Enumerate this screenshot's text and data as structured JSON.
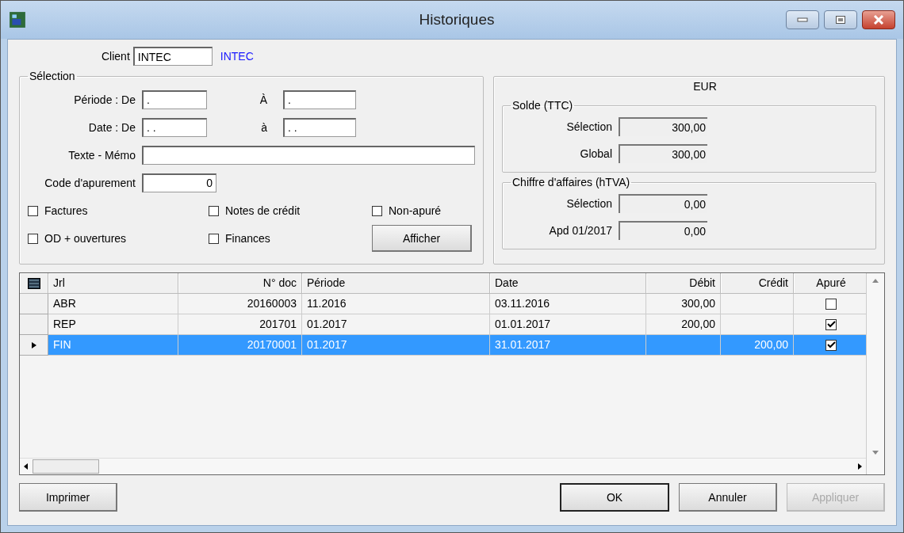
{
  "window": {
    "title": "Historiques"
  },
  "client": {
    "label": "Client",
    "value": "INTEC",
    "name": "INTEC"
  },
  "selection": {
    "title": "Sélection",
    "fields": [
      {
        "label": "Période : De",
        "value": ".",
        "to_label": "À",
        "to_value": "."
      },
      {
        "label": "Date : De",
        "value": ". .",
        "to_label": "à",
        "to_value": ". ."
      }
    ],
    "memo": {
      "label": "Texte - Mémo"
    },
    "code": {
      "label": "Code d'apurement",
      "value": "0"
    },
    "checkboxes": [
      {
        "label": "Factures",
        "checked": false
      },
      {
        "label": "Notes de crédit",
        "checked": false
      },
      {
        "label": "Non-apuré",
        "checked": false
      },
      {
        "label": "OD + ouvertures",
        "checked": false
      },
      {
        "label": "Finances",
        "checked": false
      }
    ],
    "button": "Afficher"
  },
  "totals": {
    "currency": "EUR",
    "groups": [
      {
        "title": "Solde (TTC)",
        "rows": [
          {
            "label": "Sélection",
            "value": "300,00"
          },
          {
            "label": "Global",
            "value": "300,00"
          }
        ]
      },
      {
        "title": "Chiffre d'affaires (hTVA)",
        "rows": [
          {
            "label": "Sélection",
            "value": "0,00"
          },
          {
            "label": "Apd 01/2017",
            "value": "0,00"
          }
        ]
      }
    ]
  },
  "table": {
    "columns": [
      "Jrl",
      "N° doc",
      "Période",
      "Date",
      "Débit",
      "Crédit",
      "Apuré"
    ],
    "rows": [
      {
        "selected": false,
        "cells": [
          "ABR",
          "20160003",
          "11.2016",
          "03.11.2016",
          "300,00",
          ""
        ],
        "apure": false
      },
      {
        "selected": false,
        "cells": [
          "REP",
          "201701",
          "01.2017",
          "01.01.2017",
          "200,00",
          ""
        ],
        "apure": true
      },
      {
        "selected": true,
        "cells": [
          "FIN",
          "20170001",
          "01.2017",
          "31.01.2017",
          "",
          "200,00"
        ],
        "apure": true
      }
    ]
  },
  "buttons": [
    {
      "label": "Imprimer",
      "disabled": false,
      "default": false
    },
    {
      "label": "OK",
      "disabled": false,
      "default": true
    },
    {
      "label": "Annuler",
      "disabled": false,
      "default": false
    },
    {
      "label": "Appliquer",
      "disabled": true,
      "default": false
    }
  ]
}
